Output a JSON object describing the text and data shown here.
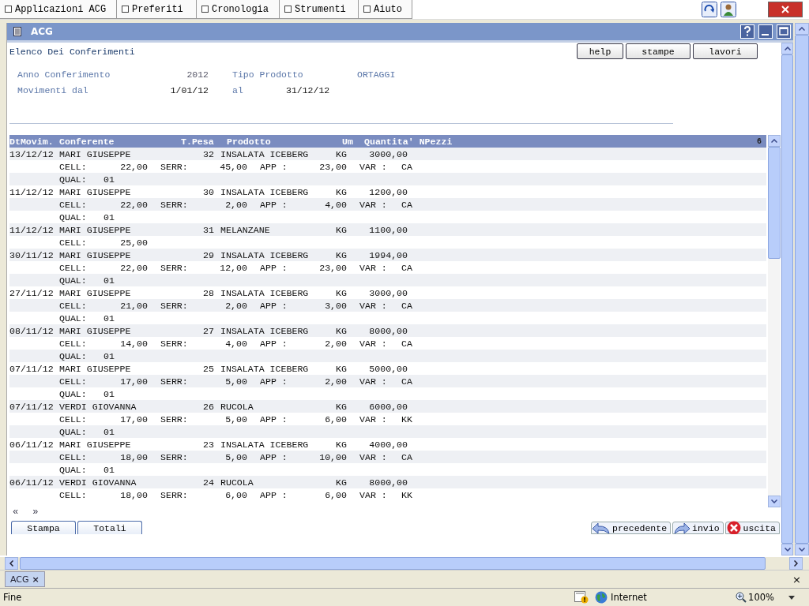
{
  "browser_tabs": [
    {
      "label": "Applicazioni ACG"
    },
    {
      "label": "Preferiti"
    },
    {
      "label": "Cronologia"
    },
    {
      "label": "Strumenti"
    },
    {
      "label": "Aiuto"
    }
  ],
  "window": {
    "title": "ACG"
  },
  "page": {
    "title": "Elenco Dei Conferimenti",
    "buttons": [
      "help",
      "stampe",
      "lavori"
    ]
  },
  "filters": [
    {
      "label": "Anno Conferimento",
      "value": "2012",
      "label2": "Tipo Prodotto",
      "value2": "ORTAGGI"
    },
    {
      "label": "Movimenti dal",
      "value": "1/01/12",
      "label2": "al",
      "value2": "31/12/12"
    }
  ],
  "table": {
    "columns": [
      "DtMovim.",
      "Conferente",
      "T.Pesa",
      "Prodotto",
      "Um",
      "Quantita'",
      "NPezzi"
    ],
    "count": "6",
    "rows": [
      {
        "date": "13/12/12",
        "conferente": "MARI GIUSEPPE",
        "t_pesa": "32",
        "prodotto": "INSALATA ICEBERG",
        "um": "KG",
        "quantita": "3000,00",
        "details": [
          {
            "label": "CELL:",
            "value": "22,00"
          },
          {
            "label": "SERR:",
            "value": "45,00"
          },
          {
            "label": "APP :",
            "value": "23,00"
          },
          {
            "label": "VAR :",
            "value": "CA"
          }
        ],
        "qual": {
          "label": "QUAL:",
          "value": "01"
        }
      },
      {
        "date": "11/12/12",
        "conferente": "MARI GIUSEPPE",
        "t_pesa": "30",
        "prodotto": "INSALATA ICEBERG",
        "um": "KG",
        "quantita": "1200,00",
        "details": [
          {
            "label": "CELL:",
            "value": "22,00"
          },
          {
            "label": "SERR:",
            "value": "2,00"
          },
          {
            "label": "APP :",
            "value": "4,00"
          },
          {
            "label": "VAR :",
            "value": "CA"
          }
        ],
        "qual": {
          "label": "QUAL:",
          "value": "01"
        }
      },
      {
        "date": "11/12/12",
        "conferente": "MARI GIUSEPPE",
        "t_pesa": "31",
        "prodotto": "MELANZANE",
        "um": "KG",
        "quantita": "1100,00",
        "details": [
          {
            "label": "CELL:",
            "value": "25,00"
          }
        ]
      },
      {
        "date": "30/11/12",
        "conferente": "MARI GIUSEPPE",
        "t_pesa": "29",
        "prodotto": "INSALATA ICEBERG",
        "um": "KG",
        "quantita": "1994,00",
        "details": [
          {
            "label": "CELL:",
            "value": "22,00"
          },
          {
            "label": "SERR:",
            "value": "12,00"
          },
          {
            "label": "APP :",
            "value": "23,00"
          },
          {
            "label": "VAR :",
            "value": "CA"
          }
        ],
        "qual": {
          "label": "QUAL:",
          "value": "01"
        }
      },
      {
        "date": "27/11/12",
        "conferente": "MARI GIUSEPPE",
        "t_pesa": "28",
        "prodotto": "INSALATA ICEBERG",
        "um": "KG",
        "quantita": "3000,00",
        "details": [
          {
            "label": "CELL:",
            "value": "21,00"
          },
          {
            "label": "SERR:",
            "value": "2,00"
          },
          {
            "label": "APP :",
            "value": "3,00"
          },
          {
            "label": "VAR :",
            "value": "CA"
          }
        ],
        "qual": {
          "label": "QUAL:",
          "value": "01"
        }
      },
      {
        "date": "08/11/12",
        "conferente": "MARI GIUSEPPE",
        "t_pesa": "27",
        "prodotto": "INSALATA ICEBERG",
        "um": "KG",
        "quantita": "8000,00",
        "details": [
          {
            "label": "CELL:",
            "value": "14,00"
          },
          {
            "label": "SERR:",
            "value": "4,00"
          },
          {
            "label": "APP :",
            "value": "2,00"
          },
          {
            "label": "VAR :",
            "value": "CA"
          }
        ],
        "qual": {
          "label": "QUAL:",
          "value": "01"
        }
      },
      {
        "date": "07/11/12",
        "conferente": "MARI GIUSEPPE",
        "t_pesa": "25",
        "prodotto": "INSALATA ICEBERG",
        "um": "KG",
        "quantita": "5000,00",
        "details": [
          {
            "label": "CELL:",
            "value": "17,00"
          },
          {
            "label": "SERR:",
            "value": "5,00"
          },
          {
            "label": "APP :",
            "value": "2,00"
          },
          {
            "label": "VAR :",
            "value": "CA"
          }
        ],
        "qual": {
          "label": "QUAL:",
          "value": "01"
        }
      },
      {
        "date": "07/11/12",
        "conferente": "VERDI GIOVANNA",
        "t_pesa": "26",
        "prodotto": "RUCOLA",
        "um": "KG",
        "quantita": "6000,00",
        "details": [
          {
            "label": "CELL:",
            "value": "17,00"
          },
          {
            "label": "SERR:",
            "value": "5,00"
          },
          {
            "label": "APP :",
            "value": "6,00"
          },
          {
            "label": "VAR :",
            "value": "KK"
          }
        ],
        "qual": {
          "label": "QUAL:",
          "value": "01"
        }
      },
      {
        "date": "06/11/12",
        "conferente": "MARI GIUSEPPE",
        "t_pesa": "23",
        "prodotto": "INSALATA ICEBERG",
        "um": "KG",
        "quantita": "4000,00",
        "details": [
          {
            "label": "CELL:",
            "value": "18,00"
          },
          {
            "label": "SERR:",
            "value": "5,00"
          },
          {
            "label": "APP :",
            "value": "10,00"
          },
          {
            "label": "VAR :",
            "value": "CA"
          }
        ],
        "qual": {
          "label": "QUAL:",
          "value": "01"
        }
      },
      {
        "date": "06/11/12",
        "conferente": "VERDI GIOVANNA",
        "t_pesa": "24",
        "prodotto": "RUCOLA",
        "um": "KG",
        "quantita": "8000,00",
        "details": [
          {
            "label": "CELL:",
            "value": "18,00"
          },
          {
            "label": "SERR:",
            "value": "6,00"
          },
          {
            "label": "APP :",
            "value": "6,00"
          },
          {
            "label": "VAR :",
            "value": "KK"
          }
        ]
      }
    ]
  },
  "pager": {
    "prev": "«",
    "next": "»"
  },
  "bottom_tabs": [
    "Stampa",
    "Totali"
  ],
  "actions": [
    {
      "kind": "back",
      "label": "precedente"
    },
    {
      "kind": "send",
      "label": "invio"
    },
    {
      "kind": "exit",
      "label": "uscita"
    }
  ],
  "document_tab": {
    "label": "ACG",
    "close": "×"
  },
  "tab_bar_close": "×",
  "status_bar": {
    "text": "Fine",
    "zone": "Internet",
    "zoom": "100%"
  }
}
